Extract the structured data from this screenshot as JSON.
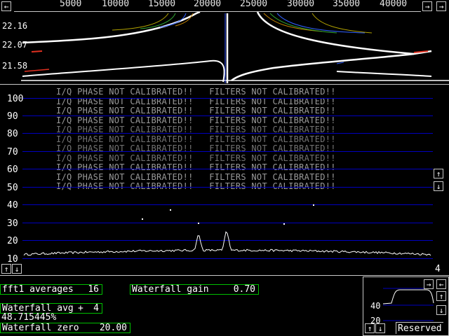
{
  "freq_axis": {
    "left_arrow": "←",
    "right_arrow": "→",
    "labels": [
      "5000",
      "10000",
      "15000",
      "20000",
      "25000",
      "30000",
      "35000",
      "40000"
    ],
    "far_right_arrow": "→"
  },
  "waterfall": {
    "y_labels": [
      "22.16",
      "22.07",
      "21.58"
    ]
  },
  "spectrum": {
    "y_labels": [
      "100",
      "90",
      "80",
      "70",
      "60",
      "50",
      "40",
      "30",
      "20",
      "10"
    ],
    "warning_text": "I/Q PHASE NOT CALIBRATED!!   FILTERS NOT CALIBRATED!!",
    "warning_repeat": 11,
    "up_arrow": "↑",
    "down_arrow": "↓",
    "corner_value": "4"
  },
  "params": {
    "fft1_averages": {
      "label": "fft1 averages",
      "value": "16"
    },
    "waterfall_gain": {
      "label": "Waterfall gain",
      "value": "0.70"
    },
    "waterfall_avg": {
      "label": "Waterfall avg",
      "value": "4"
    },
    "percent": "48.715445%",
    "waterfall_zero": {
      "label": "Waterfall zero",
      "value": "20.00"
    }
  },
  "mini": {
    "label_40": "40",
    "label_20": "20",
    "reserved": "Reserved"
  },
  "colors": {
    "grid": "#0000c0",
    "param_border": "#00c000",
    "trace": "#ffffff"
  }
}
